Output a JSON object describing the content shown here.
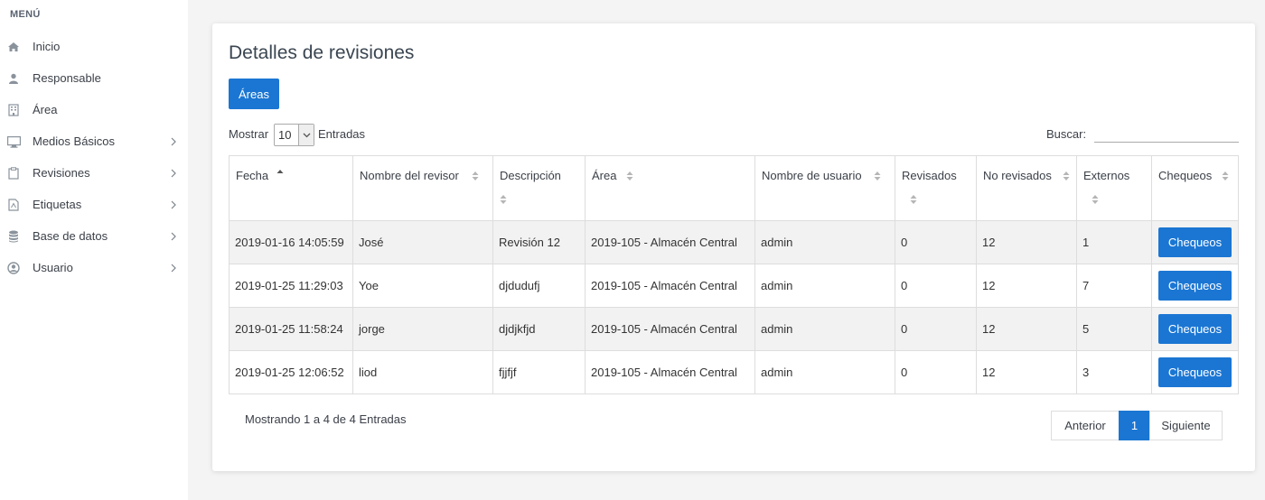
{
  "sidebar": {
    "title": "MENÚ",
    "items": [
      {
        "label": "Inicio",
        "icon": "home-icon",
        "has_submenu": false
      },
      {
        "label": "Responsable",
        "icon": "user-icon",
        "has_submenu": false
      },
      {
        "label": "Área",
        "icon": "building-icon",
        "has_submenu": false
      },
      {
        "label": "Medios Básicos",
        "icon": "monitor-icon",
        "has_submenu": true
      },
      {
        "label": "Revisiones",
        "icon": "clipboard-icon",
        "has_submenu": true
      },
      {
        "label": "Etiquetas",
        "icon": "pdf-file-icon",
        "has_submenu": true
      },
      {
        "label": "Base de datos",
        "icon": "database-icon",
        "has_submenu": true
      },
      {
        "label": "Usuario",
        "icon": "user-circle-icon",
        "has_submenu": true
      }
    ]
  },
  "main": {
    "title": "Detalles de revisiones",
    "areas_button": "Áreas",
    "length_prefix": "Mostrar",
    "length_value": "10",
    "length_suffix": "Entradas",
    "search_label": "Buscar:",
    "search_value": "",
    "columns": [
      "Fecha",
      "Nombre del revisor",
      "Descripción",
      "Área",
      "Nombre de usuario",
      "Revisados",
      "No revisados",
      "Externos",
      "Chequeos"
    ],
    "sorted_column": "Fecha",
    "sort_direction": "ascending",
    "rows": [
      {
        "fecha": "2019-01-16 14:05:59",
        "revisor": "José",
        "descripcion": "Revisión 12",
        "area": "2019-105 - Almacén Central",
        "usuario": "admin",
        "revisados": "0",
        "no_revisados": "12",
        "externos": "1",
        "accion": "Chequeos"
      },
      {
        "fecha": "2019-01-25 11:29:03",
        "revisor": "Yoe",
        "descripcion": "djdudufj",
        "area": "2019-105 - Almacén Central",
        "usuario": "admin",
        "revisados": "0",
        "no_revisados": "12",
        "externos": "7",
        "accion": "Chequeos"
      },
      {
        "fecha": "2019-01-25 11:58:24",
        "revisor": "jorge",
        "descripcion": "djdjkfjd",
        "area": "2019-105 - Almacén Central",
        "usuario": "admin",
        "revisados": "0",
        "no_revisados": "12",
        "externos": "5",
        "accion": "Chequeos"
      },
      {
        "fecha": "2019-01-25 12:06:52",
        "revisor": "liod",
        "descripcion": "fjjfjf",
        "area": "2019-105 - Almacén Central",
        "usuario": "admin",
        "revisados": "0",
        "no_revisados": "12",
        "externos": "3",
        "accion": "Chequeos"
      }
    ],
    "info": "Mostrando 1 a 4 de 4 Entradas",
    "pagination": {
      "prev": "Anterior",
      "current": "1",
      "next": "Siguiente"
    }
  },
  "colors": {
    "accent": "#1b76d3",
    "row_stripe": "#f2f2f2",
    "background": "#f4f4f4"
  }
}
